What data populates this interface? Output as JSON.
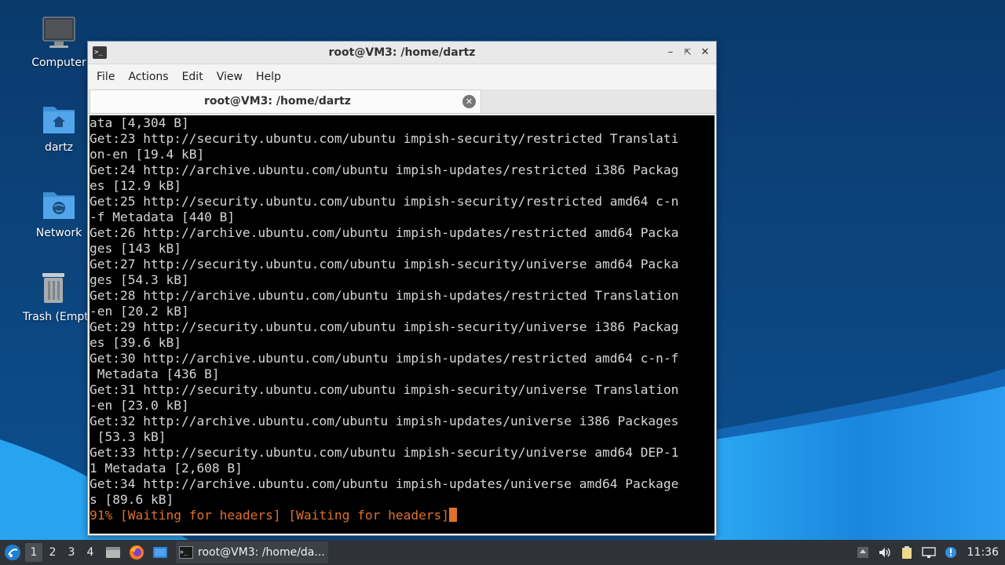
{
  "desktop": {
    "icons": [
      {
        "label": "Computer",
        "icon": "computer-icon"
      },
      {
        "label": "dartz",
        "icon": "home-folder-icon"
      },
      {
        "label": "Network",
        "icon": "network-folder-icon"
      },
      {
        "label": "Trash (Empty)",
        "icon": "trash-icon"
      }
    ]
  },
  "window": {
    "title": "root@VM3: /home/dartz",
    "menu": [
      "File",
      "Actions",
      "Edit",
      "View",
      "Help"
    ],
    "tab_label": "root@VM3: /home/dartz"
  },
  "terminal": {
    "lines": [
      "ata [4,304 B]",
      "Get:23 http://security.ubuntu.com/ubuntu impish-security/restricted Translati",
      "on-en [19.4 kB]",
      "Get:24 http://archive.ubuntu.com/ubuntu impish-updates/restricted i386 Packag",
      "es [12.9 kB]",
      "Get:25 http://security.ubuntu.com/ubuntu impish-security/restricted amd64 c-n",
      "-f Metadata [440 B]",
      "Get:26 http://archive.ubuntu.com/ubuntu impish-updates/restricted amd64 Packa",
      "ges [143 kB]",
      "Get:27 http://security.ubuntu.com/ubuntu impish-security/universe amd64 Packa",
      "ges [54.3 kB]",
      "Get:28 http://archive.ubuntu.com/ubuntu impish-updates/restricted Translation",
      "-en [20.2 kB]",
      "Get:29 http://security.ubuntu.com/ubuntu impish-security/universe i386 Packag",
      "es [39.6 kB]",
      "Get:30 http://archive.ubuntu.com/ubuntu impish-updates/restricted amd64 c-n-f",
      " Metadata [436 B]",
      "Get:31 http://security.ubuntu.com/ubuntu impish-security/universe Translation",
      "-en [23.0 kB]",
      "Get:32 http://archive.ubuntu.com/ubuntu impish-updates/universe i386 Packages",
      " [53.3 kB]",
      "Get:33 http://security.ubuntu.com/ubuntu impish-security/universe amd64 DEP-1",
      "1 Metadata [2,608 B]",
      "Get:34 http://archive.ubuntu.com/ubuntu impish-updates/universe amd64 Package",
      "s [89.6 kB]"
    ],
    "progress_line": "91% [Waiting for headers] [Waiting for headers]"
  },
  "taskbar": {
    "workspaces": [
      "1",
      "2",
      "3",
      "4"
    ],
    "active_workspace": "1",
    "task_label": "root@VM3: /home/da...",
    "clock": "11:36"
  },
  "colors": {
    "terminal_bg": "#000000",
    "terminal_fg": "#d6d6d6",
    "progress_color": "#e0712b",
    "taskbar_bg": "#2f3338",
    "wallpaper_dark": "#0b3f73",
    "wallpaper_light": "#1e8fe6"
  }
}
